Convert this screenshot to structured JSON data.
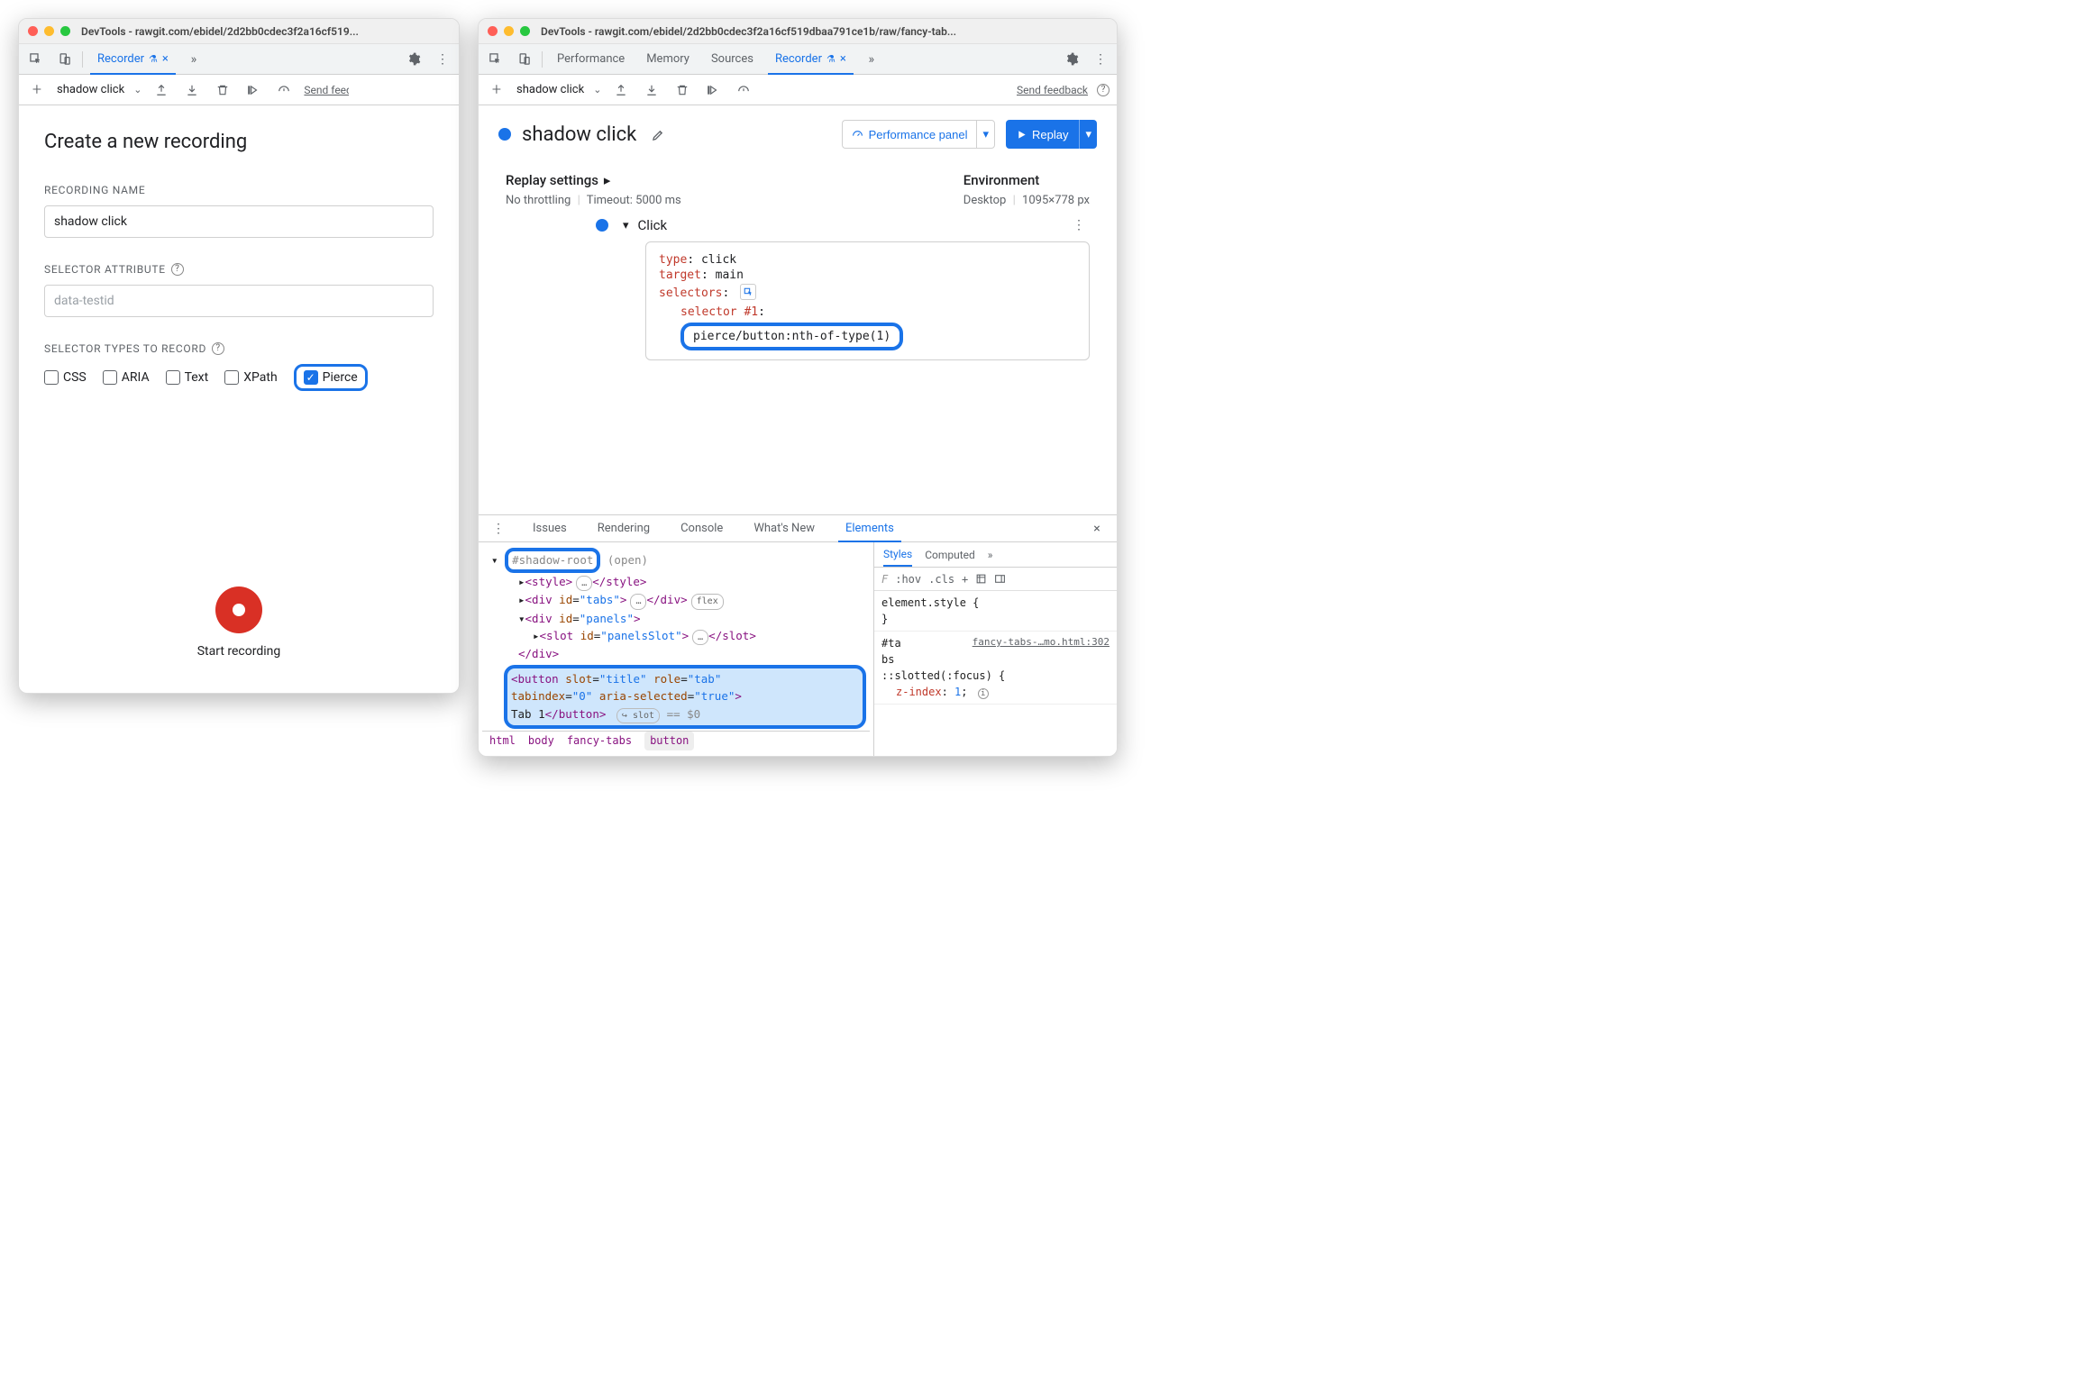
{
  "left": {
    "title": "DevTools - rawgit.com/ebidel/2d2bb0cdec3f2a16cf519...",
    "tabs": {
      "recorder": "Recorder"
    },
    "toolbar": {
      "name": "shadow click",
      "send_feedback": "Send feedback"
    },
    "create": {
      "heading": "Create a new recording",
      "name_label": "RECORDING NAME",
      "name_value": "shadow click",
      "attr_label": "SELECTOR ATTRIBUTE",
      "attr_placeholder": "data-testid",
      "types_label": "SELECTOR TYPES TO RECORD",
      "types": {
        "css": "CSS",
        "aria": "ARIA",
        "text": "Text",
        "xpath": "XPath",
        "pierce": "Pierce"
      },
      "start": "Start recording"
    }
  },
  "right": {
    "title": "DevTools - rawgit.com/ebidel/2d2bb0cdec3f2a16cf519dbaa791ce1b/raw/fancy-tab...",
    "tabs": {
      "performance": "Performance",
      "memory": "Memory",
      "sources": "Sources",
      "recorder": "Recorder"
    },
    "toolbar": {
      "name": "shadow click",
      "send_feedback": "Send feedback"
    },
    "header": {
      "title": "shadow click",
      "perf_panel": "Performance panel",
      "replay": "Replay"
    },
    "settings": {
      "replay_label": "Replay settings",
      "throttling": "No throttling",
      "timeout": "Timeout: 5000 ms",
      "env_label": "Environment",
      "device": "Desktop",
      "viewport": "1095×778 px"
    },
    "step": {
      "name": "Click",
      "type_k": "type",
      "type_v": "click",
      "target_k": "target",
      "target_v": "main",
      "selectors_k": "selectors",
      "sel1_label": "selector #1",
      "sel1_val": "pierce/button:nth-of-type(1)"
    },
    "drawer": {
      "tabs": {
        "issues": "Issues",
        "rendering": "Rendering",
        "console": "Console",
        "whatsnew": "What's New",
        "elements": "Elements"
      },
      "shadow_root": "#shadow-root",
      "shadow_open": "(open)",
      "line_style_o": "<style>",
      "line_style_c": "</style>",
      "div_tabs": "<div id=\"tabs\">",
      "div_tabs_c": "</div>",
      "flex_badge": "flex",
      "ellipsis": "…",
      "div_panels": "<div id=\"panels\">",
      "slot_panels": "<slot id=\"panelsSlot\">",
      "slot_c": "</slot>",
      "div_c": "</div>",
      "btn_line1": "<button slot=\"title\" role=\"tab\"",
      "btn_line2": "tabindex=\"0\" aria-selected=\"true\">",
      "btn_line3_txt": "Tab 1",
      "btn_line3_c": "</button>",
      "slot_badge": "slot",
      "eq_dollar": "== $0",
      "styles": {
        "tabs": {
          "styles": "Styles",
          "computed": "Computed"
        },
        "filter_placeholder": "F",
        "hov": ":hov",
        "cls": ".cls",
        "elem_style": "element.style {",
        "close": "}",
        "rule_sel": "#ta\nbs",
        "rule_src": "fancy-tabs-…mo.html:302",
        "rule_line": "::slotted(:focus) {",
        "prop": "z-index",
        "pval": "1"
      },
      "crumbs": {
        "html": "html",
        "body": "body",
        "fancy": "fancy-tabs",
        "button": "button"
      }
    }
  }
}
